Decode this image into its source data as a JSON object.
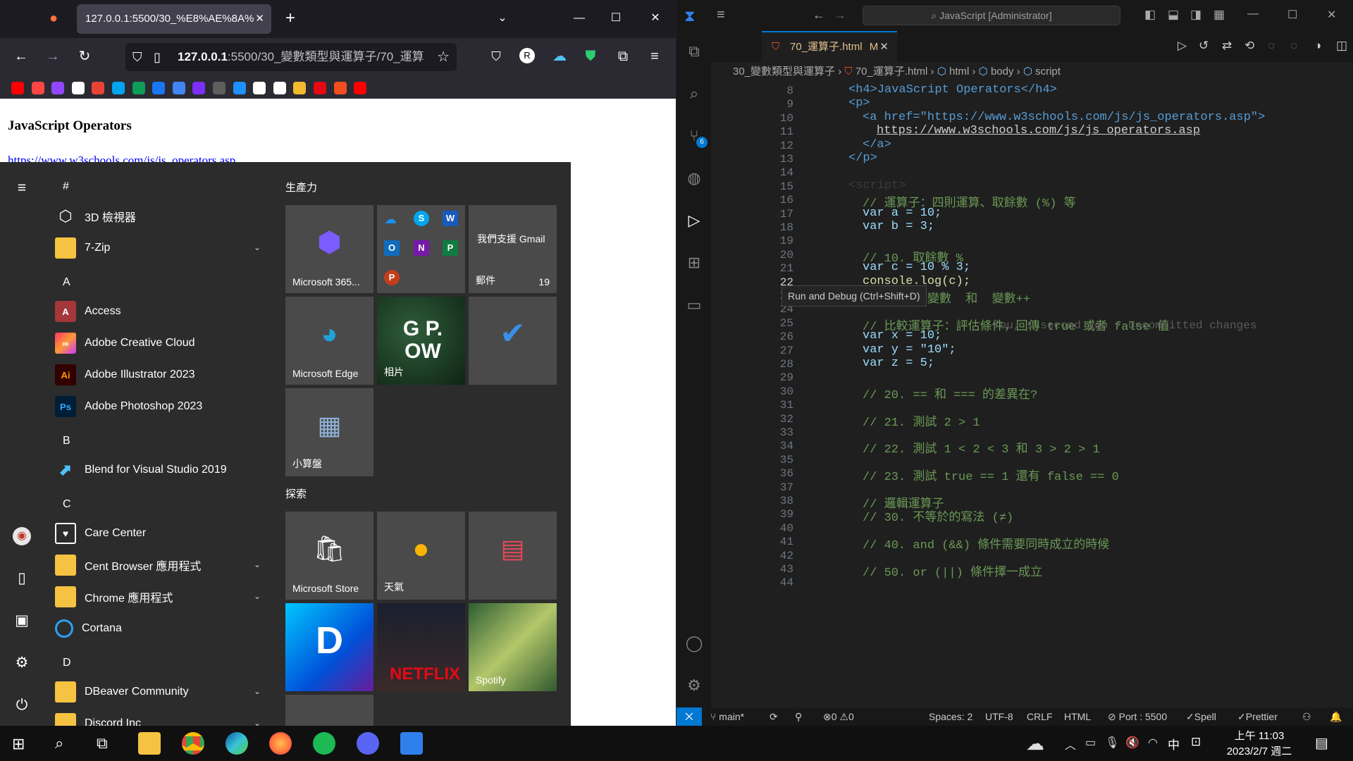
{
  "firefox": {
    "tab_title": "127.0.0.1:5500/30_%E8%AE%8A%",
    "url_host": "127.0.0.1",
    "url_rest": ":5500/30_變數類型與運算子/70_運算",
    "page_heading": "JavaScript Operators",
    "page_link": "https://www.w3schools.com/js/js_operators.asp",
    "bookmark_colors": [
      "#ff0000",
      "#ff4444",
      "#9146ff",
      "#ffffff",
      "#ea4335",
      "#00a4ef",
      "#0f9d58",
      "#1877f2",
      "#4285f4",
      "#7b2ff7",
      "#5e5e5e",
      "#1e90ff",
      "#ffffff",
      "#ffffff",
      "#f3ba2f",
      "#e50914",
      "#f24e1e"
    ],
    "bookmark_icons": [
      "youtube-icon",
      "youtube-music-icon",
      "twitch-icon",
      "docs-icon",
      "gmail-icon",
      "bookmark-icon",
      "sheets-icon",
      "facebook-icon",
      "drive-icon",
      "app-icon",
      "b-icon",
      "hashtag-icon",
      "github-icon",
      "h-icon",
      "notion-icon",
      "binance-icon",
      "netflix-icon",
      "figma-icon"
    ]
  },
  "start": {
    "group_productivity": "生產力",
    "group_explore": "探索",
    "letters": {
      "hash": "#",
      "a": "A",
      "b": "B",
      "c": "C",
      "d": "D"
    },
    "apps": [
      {
        "label": "3D 檢視器",
        "icon": "cube-icon"
      },
      {
        "label": "7-Zip",
        "icon": "folder-icon"
      },
      {
        "label": "Access",
        "icon": "access-icon"
      },
      {
        "label": "Adobe Creative Cloud",
        "icon": "creative-cloud-icon"
      },
      {
        "label": "Adobe Illustrator 2023",
        "icon": "illustrator-icon"
      },
      {
        "label": "Adobe Photoshop 2023",
        "icon": "photoshop-icon"
      },
      {
        "label": "Blend for Visual Studio 2019",
        "icon": "blend-icon"
      },
      {
        "label": "Care Center",
        "icon": "care-center-icon"
      },
      {
        "label": "Cent Browser 應用程式",
        "icon": "folder-icon"
      },
      {
        "label": "Chrome 應用程式",
        "icon": "folder-icon"
      },
      {
        "label": "Cortana",
        "icon": "cortana-icon"
      },
      {
        "label": "DBeaver Community",
        "icon": "folder-icon"
      },
      {
        "label": "Discord Inc",
        "icon": "folder-icon"
      }
    ],
    "tiles": {
      "m365": "Microsoft 365...",
      "gmail_title": "我們支援 Gmail",
      "mail": "郵件",
      "mail_count": "19",
      "edge": "Microsoft Edge",
      "photos": "相片",
      "calc": "小算盤",
      "store": "Microsoft Store",
      "weather": "天氣",
      "spotify": "Spotify",
      "netflix": "NETFLIX",
      "photos_art": "G P. OW"
    }
  },
  "vscode": {
    "search": "JavaScript [Administrator]",
    "tab": "70_運算子.html",
    "tab_flag": "M",
    "breadcrumb": [
      "30_變數類型與運算子",
      "70_運算子.html",
      "html",
      "body",
      "script"
    ],
    "tooltip": "Run and Debug (Ctrl+Shift+D)",
    "scm_badge": "6",
    "blame": "You, 1 second ago • Uncommitted changes",
    "lines": [
      {
        "n": "8",
        "code": "<h4>JavaScript Operators</h4>"
      },
      {
        "n": "9",
        "code": "<p>"
      },
      {
        "n": "10",
        "code": "<a href=\"https://www.w3schools.com/js/js_operators.asp\">"
      },
      {
        "n": "11",
        "code": "https://www.w3schools.com/js/js_operators.asp"
      },
      {
        "n": "12",
        "code": "</a>"
      },
      {
        "n": "13",
        "code": "</p>"
      },
      {
        "n": "14",
        "code": ""
      },
      {
        "n": "15",
        "code": "<script>"
      },
      {
        "n": "16",
        "code": "// 運算子：四則運算、取餘數 (%) 等"
      },
      {
        "n": "17",
        "code": "var a = 10;"
      },
      {
        "n": "18",
        "code": "var b = 3;"
      },
      {
        "n": "19",
        "code": ""
      },
      {
        "n": "20",
        "code": "// 10. 取餘數 %"
      },
      {
        "n": "21",
        "code": "var c = 10 % 3;"
      },
      {
        "n": "22",
        "code": "console.log(c);"
      },
      {
        "n": "23",
        "code": "// 11. ++變數  和  變數++"
      },
      {
        "n": "24",
        "code": ""
      },
      {
        "n": "25",
        "code": "// 比較運算子：評估條件，回傳 true 或者 false 值"
      },
      {
        "n": "26",
        "code": "var x = 10;"
      },
      {
        "n": "27",
        "code": "var y = \"10\";"
      },
      {
        "n": "28",
        "code": "var z = 5;"
      },
      {
        "n": "29",
        "code": ""
      },
      {
        "n": "30",
        "code": "// 20. == 和 === 的差異在?"
      },
      {
        "n": "31",
        "code": ""
      },
      {
        "n": "32",
        "code": "// 21. 測試 2 > 1"
      },
      {
        "n": "33",
        "code": ""
      },
      {
        "n": "34",
        "code": "// 22. 測試 1 < 2 < 3 和 3 > 2 > 1"
      },
      {
        "n": "35",
        "code": ""
      },
      {
        "n": "36",
        "code": "// 23. 測試 true == 1 還有 false == 0"
      },
      {
        "n": "37",
        "code": ""
      },
      {
        "n": "38",
        "code": "// 邏輯運算子"
      },
      {
        "n": "39",
        "code": "// 30. 不等於的寫法 (≠)"
      },
      {
        "n": "40",
        "code": ""
      },
      {
        "n": "41",
        "code": "// 40. and (&&) 條件需要同時成立的時候"
      },
      {
        "n": "42",
        "code": ""
      },
      {
        "n": "43",
        "code": "// 50. or (||) 條件擇一成立"
      },
      {
        "n": "44",
        "code": ""
      }
    ],
    "status": {
      "branch": "main*",
      "errors": "0",
      "warnings": "0",
      "spaces": "Spaces: 2",
      "encoding": "UTF-8",
      "eol": "CRLF",
      "lang": "HTML",
      "port": "Port : 5500",
      "spell": "Spell",
      "prettier": "Prettier"
    }
  },
  "taskbar": {
    "time": "上午 11:03",
    "date": "2023/2/7 週二",
    "ime": "中"
  }
}
